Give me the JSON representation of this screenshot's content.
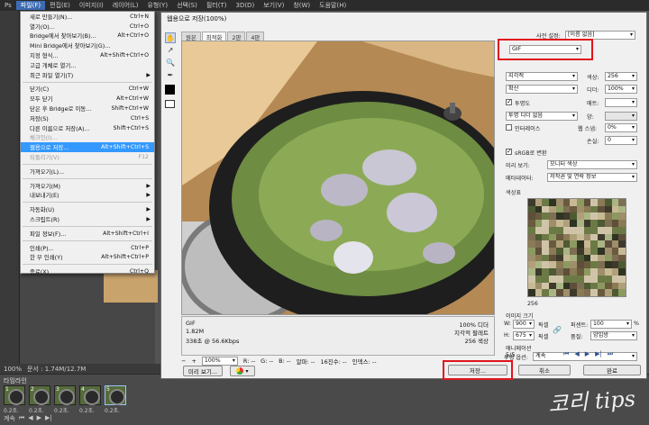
{
  "menubar": [
    "Ps",
    "파일(F)",
    "편집(E)",
    "이미지(I)",
    "레이어(L)",
    "유형(Y)",
    "선택(S)",
    "필터(T)",
    "3D(D)",
    "보기(V)",
    "창(W)",
    "도움말(H)"
  ],
  "file_menu": [
    {
      "label": "새로 만들기(N)...",
      "shortcut": "Ctrl+N"
    },
    {
      "label": "열기(O)...",
      "shortcut": "Ctrl+O"
    },
    {
      "label": "Bridge에서 찾아보기(B)...",
      "shortcut": "Alt+Ctrl+O"
    },
    {
      "label": "Mini Bridge에서 찾아보기(G)...",
      "shortcut": ""
    },
    {
      "label": "지정 형식...",
      "shortcut": "Alt+Shift+Ctrl+O"
    },
    {
      "label": "고급 개체로 열기...",
      "shortcut": ""
    },
    {
      "label": "최근 파일 열기(T)",
      "shortcut": "",
      "submenu": true
    },
    {
      "sep": true
    },
    {
      "label": "닫기(C)",
      "shortcut": "Ctrl+W"
    },
    {
      "label": "모두 닫기",
      "shortcut": "Alt+Ctrl+W"
    },
    {
      "label": "닫은 후 Bridge로 이동...",
      "shortcut": "Shift+Ctrl+W"
    },
    {
      "label": "저장(S)",
      "shortcut": "Ctrl+S"
    },
    {
      "label": "다른 이름으로 저장(A)...",
      "shortcut": "Shift+Ctrl+S"
    },
    {
      "label": "체크인(I)...",
      "shortcut": "",
      "disabled": true
    },
    {
      "label": "웹용으로 저장...",
      "shortcut": "Alt+Shift+Ctrl+S",
      "highlight": true
    },
    {
      "label": "되돌리기(V)",
      "shortcut": "F12",
      "disabled": true
    },
    {
      "sep": true
    },
    {
      "label": "가져오기(L)...",
      "shortcut": ""
    },
    {
      "sep": true
    },
    {
      "label": "가져오기(M)",
      "shortcut": "",
      "submenu": true
    },
    {
      "label": "내보내기(E)",
      "shortcut": "",
      "submenu": true
    },
    {
      "sep": true
    },
    {
      "label": "자동화(U)",
      "shortcut": "",
      "submenu": true
    },
    {
      "label": "스크립트(R)",
      "shortcut": "",
      "submenu": true
    },
    {
      "sep": true
    },
    {
      "label": "파일 정보(F)...",
      "shortcut": "Alt+Shift+Ctrl+I"
    },
    {
      "sep": true
    },
    {
      "label": "인쇄(P)...",
      "shortcut": "Ctrl+P"
    },
    {
      "label": "한 부 인쇄(Y)",
      "shortcut": "Alt+Shift+Ctrl+P"
    },
    {
      "sep": true
    },
    {
      "label": "종료(X)",
      "shortcut": "Ctrl+Q"
    }
  ],
  "status": {
    "zoom": "100%",
    "doc": "문서 : 1.74M/12.7M"
  },
  "timeline": {
    "title": "타임라인",
    "frames": [
      {
        "num": "1",
        "dur": "0.2초."
      },
      {
        "num": "2",
        "dur": "0.2초."
      },
      {
        "num": "3",
        "dur": "0.2초."
      },
      {
        "num": "4",
        "dur": "0.2초."
      },
      {
        "num": "5",
        "dur": "0.2초."
      }
    ],
    "loop": "계속"
  },
  "dialog": {
    "title": "웹용으로 저장(100%)",
    "tabs": [
      "원본",
      "최적화",
      "2판",
      "4판"
    ],
    "info_left": {
      "format": "GIF",
      "size": "1.82M",
      "time": "338초 @ 56.6Kbps"
    },
    "info_right": {
      "dither": "100% 디더",
      "palette": "지각적 팔레트",
      "colors": "256 색상"
    },
    "zoom": "100%",
    "readouts": [
      "R: --",
      "G: --",
      "B: --",
      "알파: --",
      "16진수: --",
      "인덱스: --"
    ],
    "buttons": {
      "preview": "미리 보기...",
      "save": "저장...",
      "cancel": "취소",
      "done": "완료"
    },
    "right": {
      "preset_label": "사전 설정:",
      "preset_value": "[이름 없음]",
      "format": "GIF",
      "reduction": "지각적",
      "dither_algo": "확산",
      "colors_label": "색상:",
      "colors_value": "256",
      "dither_label": "디더:",
      "dither_value": "100%",
      "transparency": "투명도",
      "matte_label": "매트:",
      "trans_dither": "투명 디더 없음",
      "amount_label": "양:",
      "interlaced": "인터레이스",
      "websnap_label": "웹 스냅:",
      "websnap_value": "0%",
      "lossy_label": "손실:",
      "lossy_value": "0",
      "srgb": "sRGB로 변환",
      "preview_label": "미리 보기:",
      "preview_value": "모니터 색상",
      "metadata_label": "메타데이터:",
      "metadata_value": "저작권 및 연락 정보",
      "colortable_label": "색상표",
      "colortable_count": "256",
      "imagesize_label": "이미지 크기",
      "w_label": "W:",
      "w_value": "900",
      "h_label": "H:",
      "h_value": "675",
      "px": "픽셀",
      "percent_label": "퍼센트:",
      "percent_value": "100",
      "pct": "%",
      "quality_label": "품질:",
      "quality_value": "양입방",
      "anim_label": "애니메이션",
      "loop_label": "루핑 옵션:",
      "loop_value": "계속",
      "frame_counter": "5/5"
    }
  },
  "watermark": "코리 tips",
  "colors": {
    "highlight": "#3399ff",
    "red_box": "#e0141e"
  }
}
